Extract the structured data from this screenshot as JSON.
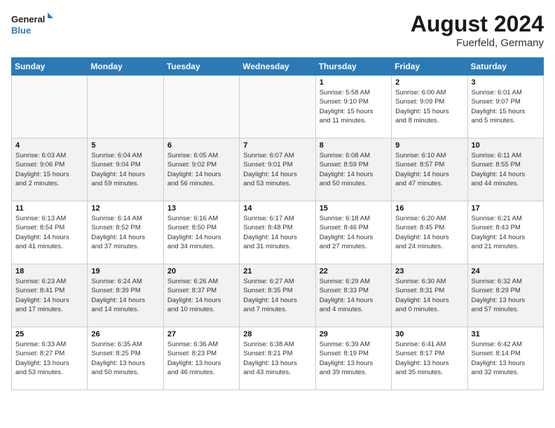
{
  "header": {
    "logo_general": "General",
    "logo_blue": "Blue",
    "month_year": "August 2024",
    "location": "Fuerfeld, Germany"
  },
  "days_of_week": [
    "Sunday",
    "Monday",
    "Tuesday",
    "Wednesday",
    "Thursday",
    "Friday",
    "Saturday"
  ],
  "weeks": [
    [
      {
        "day": "",
        "info": "",
        "empty": true
      },
      {
        "day": "",
        "info": "",
        "empty": true
      },
      {
        "day": "",
        "info": "",
        "empty": true
      },
      {
        "day": "",
        "info": "",
        "empty": true
      },
      {
        "day": "1",
        "info": "Sunrise: 5:58 AM\nSunset: 9:10 PM\nDaylight: 15 hours\nand 11 minutes."
      },
      {
        "day": "2",
        "info": "Sunrise: 6:00 AM\nSunset: 9:09 PM\nDaylight: 15 hours\nand 8 minutes."
      },
      {
        "day": "3",
        "info": "Sunrise: 6:01 AM\nSunset: 9:07 PM\nDaylight: 15 hours\nand 5 minutes."
      }
    ],
    [
      {
        "day": "4",
        "info": "Sunrise: 6:03 AM\nSunset: 9:06 PM\nDaylight: 15 hours\nand 2 minutes."
      },
      {
        "day": "5",
        "info": "Sunrise: 6:04 AM\nSunset: 9:04 PM\nDaylight: 14 hours\nand 59 minutes."
      },
      {
        "day": "6",
        "info": "Sunrise: 6:05 AM\nSunset: 9:02 PM\nDaylight: 14 hours\nand 56 minutes."
      },
      {
        "day": "7",
        "info": "Sunrise: 6:07 AM\nSunset: 9:01 PM\nDaylight: 14 hours\nand 53 minutes."
      },
      {
        "day": "8",
        "info": "Sunrise: 6:08 AM\nSunset: 8:59 PM\nDaylight: 14 hours\nand 50 minutes."
      },
      {
        "day": "9",
        "info": "Sunrise: 6:10 AM\nSunset: 8:57 PM\nDaylight: 14 hours\nand 47 minutes."
      },
      {
        "day": "10",
        "info": "Sunrise: 6:11 AM\nSunset: 8:55 PM\nDaylight: 14 hours\nand 44 minutes."
      }
    ],
    [
      {
        "day": "11",
        "info": "Sunrise: 6:13 AM\nSunset: 8:54 PM\nDaylight: 14 hours\nand 41 minutes."
      },
      {
        "day": "12",
        "info": "Sunrise: 6:14 AM\nSunset: 8:52 PM\nDaylight: 14 hours\nand 37 minutes."
      },
      {
        "day": "13",
        "info": "Sunrise: 6:16 AM\nSunset: 8:50 PM\nDaylight: 14 hours\nand 34 minutes."
      },
      {
        "day": "14",
        "info": "Sunrise: 6:17 AM\nSunset: 8:48 PM\nDaylight: 14 hours\nand 31 minutes."
      },
      {
        "day": "15",
        "info": "Sunrise: 6:18 AM\nSunset: 8:46 PM\nDaylight: 14 hours\nand 27 minutes."
      },
      {
        "day": "16",
        "info": "Sunrise: 6:20 AM\nSunset: 8:45 PM\nDaylight: 14 hours\nand 24 minutes."
      },
      {
        "day": "17",
        "info": "Sunrise: 6:21 AM\nSunset: 8:43 PM\nDaylight: 14 hours\nand 21 minutes."
      }
    ],
    [
      {
        "day": "18",
        "info": "Sunrise: 6:23 AM\nSunset: 8:41 PM\nDaylight: 14 hours\nand 17 minutes."
      },
      {
        "day": "19",
        "info": "Sunrise: 6:24 AM\nSunset: 8:39 PM\nDaylight: 14 hours\nand 14 minutes."
      },
      {
        "day": "20",
        "info": "Sunrise: 6:26 AM\nSunset: 8:37 PM\nDaylight: 14 hours\nand 10 minutes."
      },
      {
        "day": "21",
        "info": "Sunrise: 6:27 AM\nSunset: 8:35 PM\nDaylight: 14 hours\nand 7 minutes."
      },
      {
        "day": "22",
        "info": "Sunrise: 6:29 AM\nSunset: 8:33 PM\nDaylight: 14 hours\nand 4 minutes."
      },
      {
        "day": "23",
        "info": "Sunrise: 6:30 AM\nSunset: 8:31 PM\nDaylight: 14 hours\nand 0 minutes."
      },
      {
        "day": "24",
        "info": "Sunrise: 6:32 AM\nSunset: 8:29 PM\nDaylight: 13 hours\nand 57 minutes."
      }
    ],
    [
      {
        "day": "25",
        "info": "Sunrise: 6:33 AM\nSunset: 8:27 PM\nDaylight: 13 hours\nand 53 minutes."
      },
      {
        "day": "26",
        "info": "Sunrise: 6:35 AM\nSunset: 8:25 PM\nDaylight: 13 hours\nand 50 minutes."
      },
      {
        "day": "27",
        "info": "Sunrise: 6:36 AM\nSunset: 8:23 PM\nDaylight: 13 hours\nand 46 minutes."
      },
      {
        "day": "28",
        "info": "Sunrise: 6:38 AM\nSunset: 8:21 PM\nDaylight: 13 hours\nand 43 minutes."
      },
      {
        "day": "29",
        "info": "Sunrise: 6:39 AM\nSunset: 8:19 PM\nDaylight: 13 hours\nand 39 minutes."
      },
      {
        "day": "30",
        "info": "Sunrise: 6:41 AM\nSunset: 8:17 PM\nDaylight: 13 hours\nand 35 minutes."
      },
      {
        "day": "31",
        "info": "Sunrise: 6:42 AM\nSunset: 8:14 PM\nDaylight: 13 hours\nand 32 minutes."
      }
    ]
  ]
}
